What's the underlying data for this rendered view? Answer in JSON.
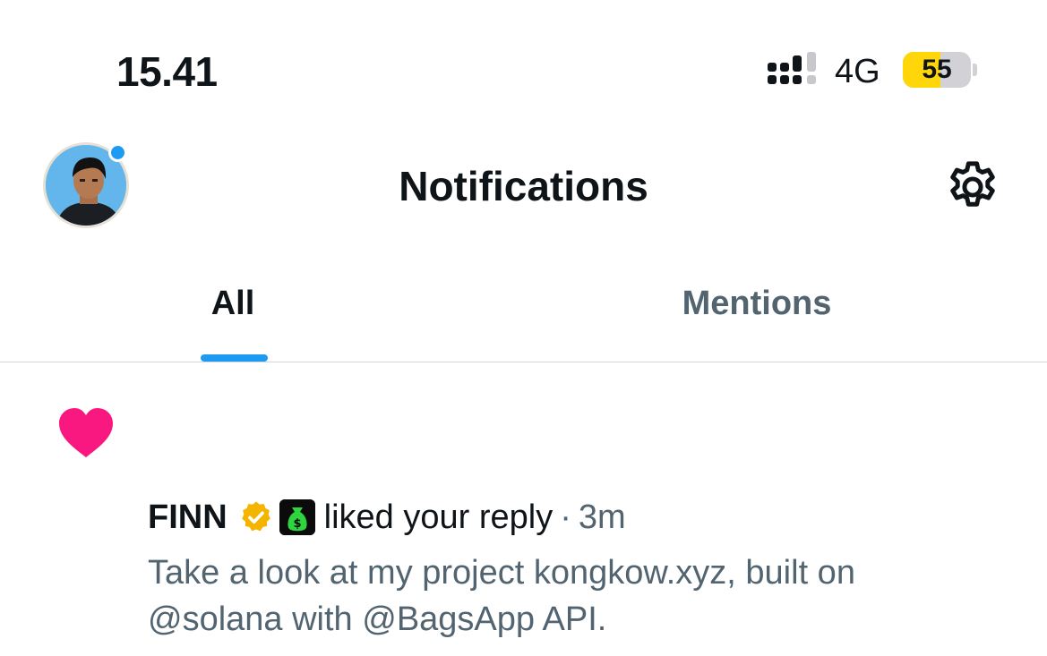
{
  "status_bar": {
    "time": "15.41",
    "network": "4G",
    "battery_level": "55",
    "battery_fraction": 0.55,
    "battery_color": "#ffd60a",
    "signal_icon": "signal-bars-icon"
  },
  "header": {
    "title": "Notifications",
    "avatar_icon": "profile-avatar",
    "settings_icon": "gear-icon",
    "unread_dot_color": "#1d9bf0"
  },
  "tabs": [
    {
      "label": "All",
      "active": true
    },
    {
      "label": "Mentions",
      "active": false
    }
  ],
  "notifications": [
    {
      "icon": "heart-icon",
      "icon_color": "#f91880",
      "user_name": "FINN",
      "badges": [
        "verified-badge-icon",
        "money-bag-icon"
      ],
      "action": "liked your reply",
      "separator": "·",
      "time_ago": "3m",
      "body": "Take a look at my project kongkow.xyz, built on @solana with @BagsApp API."
    }
  ],
  "colors": {
    "accent": "#1d9bf0",
    "like": "#f91880",
    "secondary_text": "#536471",
    "gold_badge": "#f4b400",
    "bag_green": "#2ed53f"
  }
}
